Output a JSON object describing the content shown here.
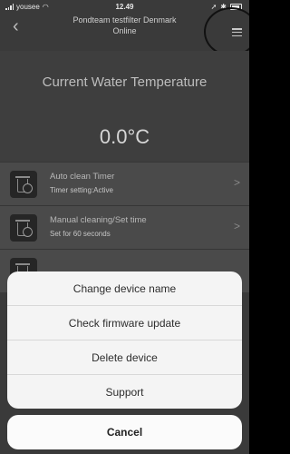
{
  "status_bar": {
    "carrier": "yousee",
    "time": "12.49"
  },
  "nav": {
    "title": "Pondteam testfilter Denmark",
    "subtitle": "Online"
  },
  "temperature": {
    "title": "Current Water Temperature",
    "value": "0.0°C"
  },
  "list": [
    {
      "title": "Auto clean Timer",
      "subtitle": "Timer setting:Active"
    },
    {
      "title": "Manual cleaning/Set time",
      "subtitle": "Set for 60 seconds"
    }
  ],
  "action_sheet": {
    "items": [
      "Change device name",
      "Check firmware update",
      "Delete device",
      "Support"
    ],
    "cancel": "Cancel"
  }
}
